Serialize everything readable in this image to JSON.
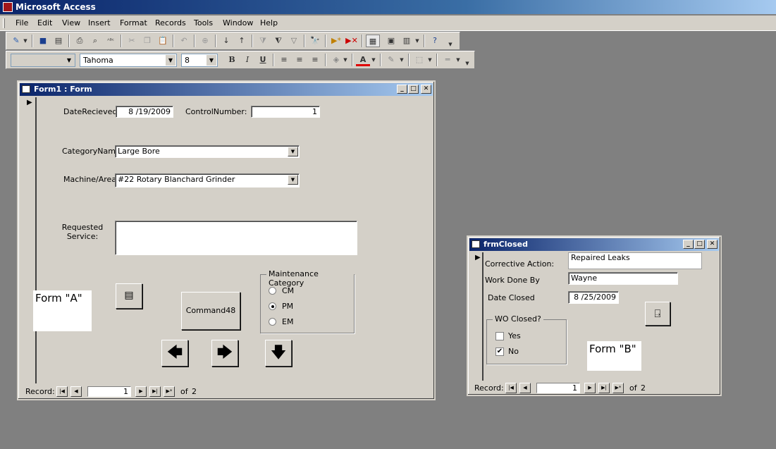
{
  "app": {
    "title": "Microsoft Access"
  },
  "menu": [
    "File",
    "Edit",
    "View",
    "Insert",
    "Format",
    "Records",
    "Tools",
    "Window",
    "Help"
  ],
  "format_toolbar": {
    "font": "Tahoma",
    "size": "8",
    "bold": "B",
    "italic": "I",
    "underline": "U",
    "font_color": "A"
  },
  "form1": {
    "title": "Form1 : Form",
    "date_label": "DateRecieved:",
    "date_value": "8 /19/2009",
    "control_label": "ControlNumber:",
    "control_value": "1",
    "category_label": "CategoryName",
    "category_value": "Large Bore",
    "machine_label": "Machine/Area",
    "machine_value": "#22 Rotary Blanchard Grinder",
    "requested_label": "Requested\nService:",
    "requested_value": "",
    "command_label": "Command48",
    "maint_caption": "Maintenance Category",
    "maint_options": [
      "CM",
      "PM",
      "EM"
    ],
    "maint_selected": "PM",
    "form_a_label": "Form \"A\"",
    "record_label": "Record:",
    "record_current": "1",
    "record_of": "of",
    "record_total": "2"
  },
  "form2": {
    "title": "frmClosed",
    "corrective_label": "Corrective Action:",
    "corrective_value": "Repaired Leaks",
    "workdone_label": "Work Done By",
    "workdone_value": "Wayne",
    "dateclosed_label": "Date Closed",
    "dateclosed_value": "8 /25/2009",
    "woclosed_caption": "WO Closed?",
    "yes_label": "Yes",
    "no_label": "No",
    "no_checked": true,
    "form_b_label": "Form \"B\"",
    "record_label": "Record:",
    "record_current": "1",
    "record_of": "of",
    "record_total": "2"
  }
}
